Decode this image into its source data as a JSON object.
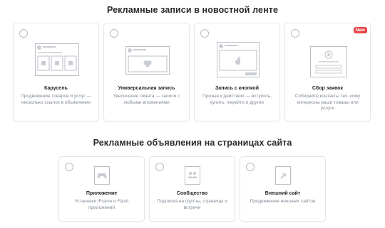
{
  "sections": {
    "feed_title": "Рекламные записи в новостной ленте",
    "site_title": "Рекламные объявления на страницах сайта"
  },
  "feed_cards": [
    {
      "title": "Карусель",
      "desc": "Продвижение товаров и услуг — несколько ссылок в объявлении",
      "icon": "carousel-illustration"
    },
    {
      "title": "Универсальная запись",
      "desc": "Увеличение охвата — записи с любыми вложениями",
      "icon": "heart-post-illustration"
    },
    {
      "title": "Запись с кнопкой",
      "desc": "Призыв к действию — вступить, купить, перейти и другие",
      "icon": "flame-button-illustration"
    },
    {
      "title": "Сбор заявок",
      "desc": "Собирайте контакты тех, кому интересны ваши товары или услуги",
      "icon": "form-illustration",
      "badge": "New"
    }
  ],
  "site_cards": [
    {
      "title": "Приложение",
      "desc": "Установки iFrame и Flash приложений",
      "icon": "gamepad-icon"
    },
    {
      "title": "Сообщество",
      "desc": "Подписка на группы, страницы и встречи",
      "icon": "group-icon"
    },
    {
      "title": "Внешний сайт",
      "desc": "Продвижение внешних сайтов",
      "icon": "external-link-icon"
    }
  ],
  "colors": {
    "stroke": "#b9bec6",
    "fill": "#c9cdd3",
    "badge": "#e64646"
  }
}
